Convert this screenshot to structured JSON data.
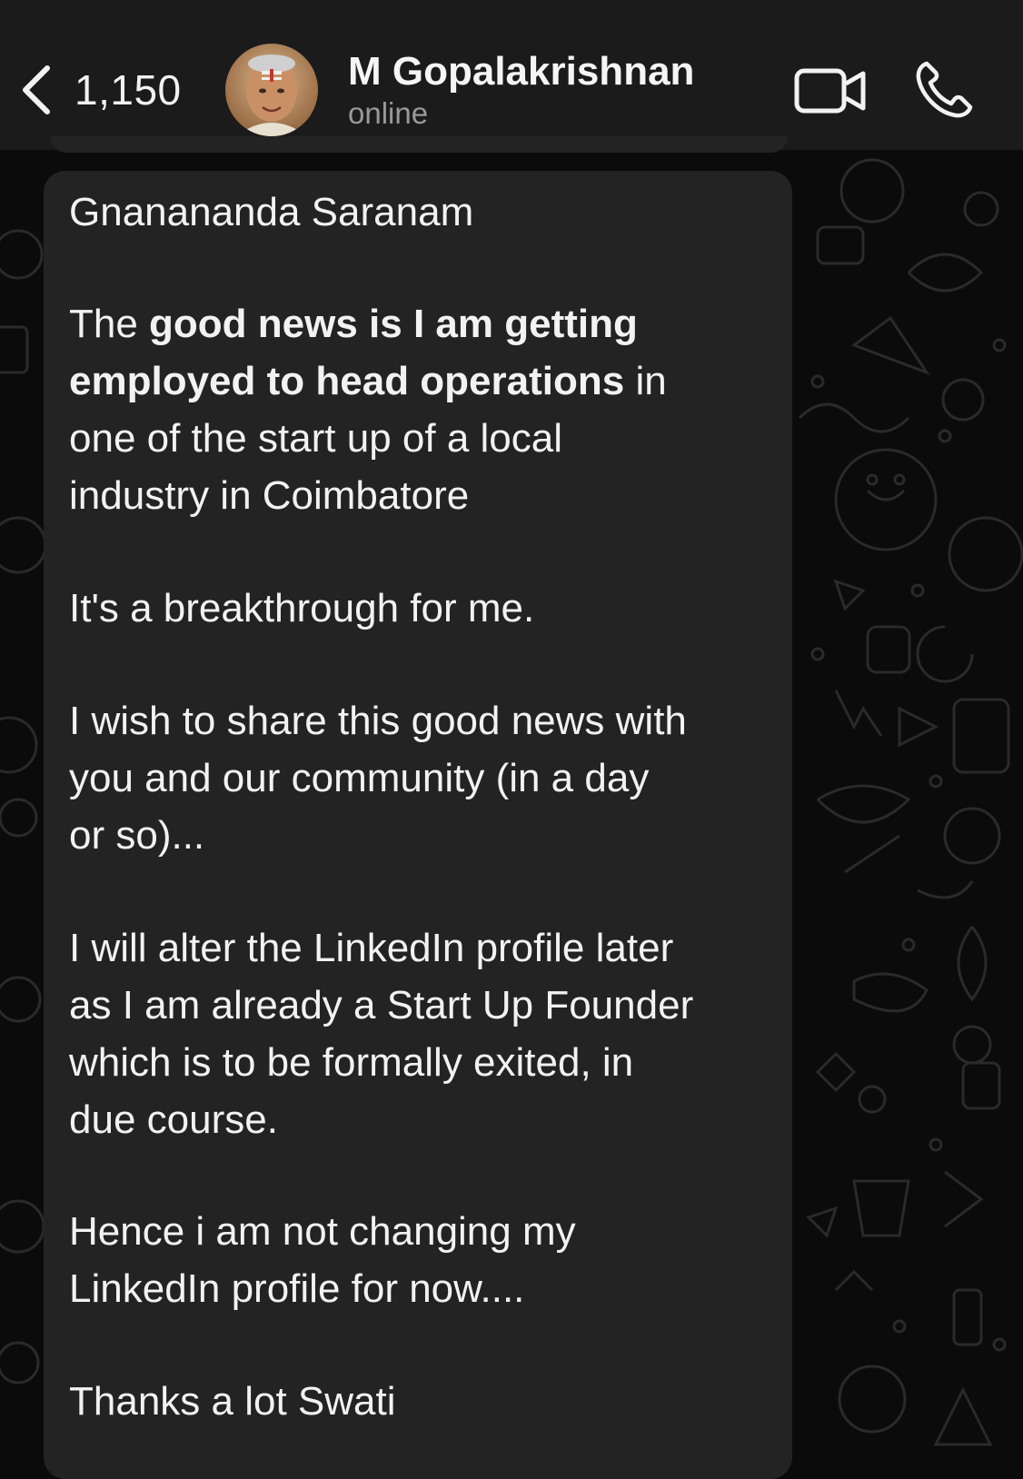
{
  "header": {
    "back_count": "1,150",
    "contact_name": "M Gopalakrishnan",
    "status": "online",
    "icons": [
      "chevron-left-icon",
      "video-camera-icon",
      "phone-icon"
    ]
  },
  "message": {
    "lines": [
      "Gnanananda Saranam",
      "The ",
      "good news is I am getting",
      "employed to head operations",
      " in",
      "one of the start up of a local",
      "industry in Coimbatore",
      "It's a breakthrough for me.",
      "I wish to share this good news with",
      "you and our community (in a day",
      "or so)...",
      "I will alter the LinkedIn profile later",
      "as I am already a Start Up Founder",
      "which is to be formally exited, in",
      "due course.",
      "Hence i am not changing my",
      "LinkedIn profile for now....",
      "Thanks a lot Swati"
    ]
  },
  "colors": {
    "header_bg": "#1b1b1b",
    "bubble_bg": "#232323",
    "chat_bg": "#0b0b0b",
    "text": "#f2f2f2",
    "status_text": "#9a9a9a"
  }
}
